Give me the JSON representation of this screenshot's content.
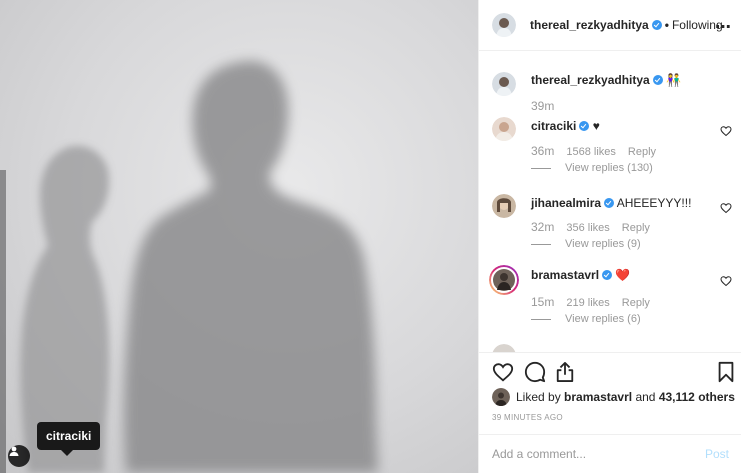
{
  "post": {
    "author": "thereal_rezkyadhitya",
    "follow_dot": "•",
    "follow_status": "Following",
    "more_icon": "more-icon",
    "caption_emoji": "👫",
    "caption_time": "39m"
  },
  "photo": {
    "tag_label": "citraciki",
    "tag_icon": "user-tag-icon"
  },
  "comments": [
    {
      "user": "citraciki",
      "text": "♥",
      "time": "36m",
      "likes": "1568 likes",
      "reply": "Reply",
      "view_replies": "View replies (130)"
    },
    {
      "user": "jihanealmira",
      "text": "AHEEEYYY!!!",
      "time": "32m",
      "likes": "356 likes",
      "reply": "Reply",
      "view_replies": "View replies (9)"
    },
    {
      "user": "bramastavrl",
      "text": "❤️",
      "time": "15m",
      "likes": "219 likes",
      "reply": "Reply",
      "view_replies": "View replies (6)"
    }
  ],
  "actions": {
    "like_icon": "heart-icon",
    "comment_icon": "comment-icon",
    "share_icon": "share-icon",
    "save_icon": "bookmark-icon"
  },
  "likes_summary": {
    "prefix": "Liked by",
    "user": "bramastavrl",
    "conjunction": "and",
    "others": "43,112 others"
  },
  "timestamp": "39 MINUTES AGO",
  "add_comment": {
    "placeholder": "Add a comment...",
    "post_label": "Post"
  },
  "colors": {
    "verified": "#3897f0",
    "text": "#262626",
    "muted": "#999999",
    "post_disabled": "#b2dffc"
  }
}
